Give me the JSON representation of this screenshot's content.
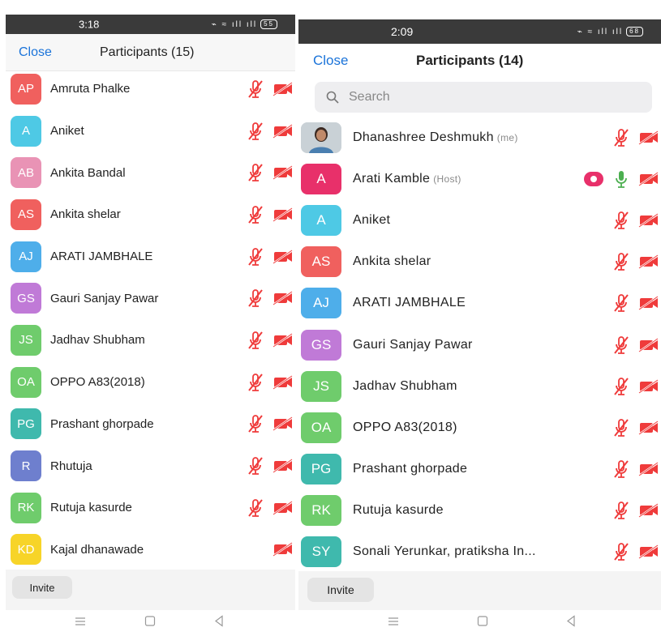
{
  "left": {
    "status": {
      "time": "3:18",
      "battery": "55"
    },
    "header": {
      "close_label": "Close",
      "title": "Participants (15)"
    },
    "participants": [
      {
        "initials": "AP",
        "name": "Amruta Phalke",
        "color": "#f0605e",
        "muted": true,
        "video_off": true
      },
      {
        "initials": "A",
        "name": "Aniket",
        "color": "#4ec9e5",
        "muted": true,
        "video_off": true
      },
      {
        "initials": "AB",
        "name": "Ankita Bandal",
        "color": "#e993b5",
        "muted": true,
        "video_off": true
      },
      {
        "initials": "AS",
        "name": "Ankita shelar",
        "color": "#f0605e",
        "muted": true,
        "video_off": true
      },
      {
        "initials": "AJ",
        "name": "ARATI JAMBHALE",
        "color": "#4eaeea",
        "muted": true,
        "video_off": true
      },
      {
        "initials": "GS",
        "name": "Gauri Sanjay Pawar",
        "color": "#c07ad7",
        "muted": true,
        "video_off": true
      },
      {
        "initials": "JS",
        "name": "Jadhav Shubham",
        "color": "#6fcc6c",
        "muted": true,
        "video_off": true
      },
      {
        "initials": "OA",
        "name": "OPPO A83(2018)",
        "color": "#6fcc6c",
        "muted": true,
        "video_off": true
      },
      {
        "initials": "PG",
        "name": "Prashant ghorpade",
        "color": "#3fb9ad",
        "muted": true,
        "video_off": true
      },
      {
        "initials": "R",
        "name": "Rhutuja",
        "color": "#6e7fce",
        "muted": true,
        "video_off": true
      },
      {
        "initials": "RK",
        "name": "Rutuja kasurde",
        "color": "#6fcc6c",
        "muted": true,
        "video_off": true
      },
      {
        "initials": "KD",
        "name": "Kajal dhanawade",
        "color": "#f7d428",
        "muted": false,
        "video_off": true
      }
    ],
    "footer": {
      "invite_label": "Invite"
    }
  },
  "right": {
    "status": {
      "time": "2:09",
      "battery": "68"
    },
    "header": {
      "close_label": "Close",
      "title": "Participants (14)"
    },
    "search": {
      "placeholder": "Search"
    },
    "participants": [
      {
        "initials": "",
        "photo": true,
        "name": "Dhanashree Deshmukh",
        "tag": "(me)",
        "color": "#cdd3d8",
        "muted": true,
        "video_off": true
      },
      {
        "initials": "A",
        "name": "Arati Kamble",
        "tag": "(Host)",
        "color": "#e8306a",
        "recording": true,
        "muted": false,
        "video_off": true
      },
      {
        "initials": "A",
        "name": "Aniket",
        "color": "#4ec9e5",
        "muted": true,
        "video_off": true
      },
      {
        "initials": "AS",
        "name": "Ankita shelar",
        "color": "#f0605e",
        "muted": true,
        "video_off": true
      },
      {
        "initials": "AJ",
        "name": "ARATI JAMBHALE",
        "color": "#4eaeea",
        "muted": true,
        "video_off": true
      },
      {
        "initials": "GS",
        "name": "Gauri Sanjay Pawar",
        "color": "#c07ad7",
        "muted": true,
        "video_off": true
      },
      {
        "initials": "JS",
        "name": "Jadhav Shubham",
        "color": "#6fcc6c",
        "muted": true,
        "video_off": true
      },
      {
        "initials": "OA",
        "name": "OPPO A83(2018)",
        "color": "#6fcc6c",
        "muted": true,
        "video_off": true
      },
      {
        "initials": "PG",
        "name": "Prashant ghorpade",
        "color": "#3fb9ad",
        "muted": true,
        "video_off": true
      },
      {
        "initials": "RK",
        "name": "Rutuja kasurde",
        "color": "#6fcc6c",
        "muted": true,
        "video_off": true
      },
      {
        "initials": "SY",
        "name": "Sonali Yerunkar, pratiksha In...",
        "color": "#3fb9ad",
        "muted": true,
        "video_off": true
      }
    ],
    "footer": {
      "invite_label": "Invite"
    }
  },
  "icons": {
    "mic_muted": "mic-muted-icon",
    "mic_on": "mic-on-icon",
    "video_off": "video-off-icon",
    "record": "record-icon",
    "search": "search-icon",
    "nav_menu": "menu-icon",
    "nav_home": "home-icon",
    "nav_back": "back-icon"
  },
  "colors": {
    "accent": "#1a73d9",
    "muted_red": "#ef3b3b",
    "mic_green": "#4caf50"
  }
}
